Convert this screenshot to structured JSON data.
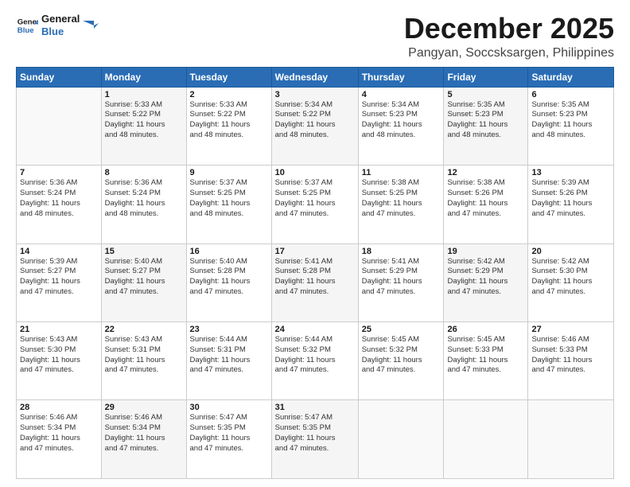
{
  "logo": {
    "line1": "General",
    "line2": "Blue"
  },
  "title": "December 2025",
  "subtitle": "Pangyan, Soccsksargen, Philippines",
  "weekdays": [
    "Sunday",
    "Monday",
    "Tuesday",
    "Wednesday",
    "Thursday",
    "Friday",
    "Saturday"
  ],
  "weeks": [
    [
      {
        "day": "",
        "info": ""
      },
      {
        "day": "1",
        "info": "Sunrise: 5:33 AM\nSunset: 5:22 PM\nDaylight: 11 hours\nand 48 minutes."
      },
      {
        "day": "2",
        "info": "Sunrise: 5:33 AM\nSunset: 5:22 PM\nDaylight: 11 hours\nand 48 minutes."
      },
      {
        "day": "3",
        "info": "Sunrise: 5:34 AM\nSunset: 5:22 PM\nDaylight: 11 hours\nand 48 minutes."
      },
      {
        "day": "4",
        "info": "Sunrise: 5:34 AM\nSunset: 5:23 PM\nDaylight: 11 hours\nand 48 minutes."
      },
      {
        "day": "5",
        "info": "Sunrise: 5:35 AM\nSunset: 5:23 PM\nDaylight: 11 hours\nand 48 minutes."
      },
      {
        "day": "6",
        "info": "Sunrise: 5:35 AM\nSunset: 5:23 PM\nDaylight: 11 hours\nand 48 minutes."
      }
    ],
    [
      {
        "day": "7",
        "info": "Sunrise: 5:36 AM\nSunset: 5:24 PM\nDaylight: 11 hours\nand 48 minutes."
      },
      {
        "day": "8",
        "info": "Sunrise: 5:36 AM\nSunset: 5:24 PM\nDaylight: 11 hours\nand 48 minutes."
      },
      {
        "day": "9",
        "info": "Sunrise: 5:37 AM\nSunset: 5:25 PM\nDaylight: 11 hours\nand 48 minutes."
      },
      {
        "day": "10",
        "info": "Sunrise: 5:37 AM\nSunset: 5:25 PM\nDaylight: 11 hours\nand 47 minutes."
      },
      {
        "day": "11",
        "info": "Sunrise: 5:38 AM\nSunset: 5:25 PM\nDaylight: 11 hours\nand 47 minutes."
      },
      {
        "day": "12",
        "info": "Sunrise: 5:38 AM\nSunset: 5:26 PM\nDaylight: 11 hours\nand 47 minutes."
      },
      {
        "day": "13",
        "info": "Sunrise: 5:39 AM\nSunset: 5:26 PM\nDaylight: 11 hours\nand 47 minutes."
      }
    ],
    [
      {
        "day": "14",
        "info": "Sunrise: 5:39 AM\nSunset: 5:27 PM\nDaylight: 11 hours\nand 47 minutes."
      },
      {
        "day": "15",
        "info": "Sunrise: 5:40 AM\nSunset: 5:27 PM\nDaylight: 11 hours\nand 47 minutes."
      },
      {
        "day": "16",
        "info": "Sunrise: 5:40 AM\nSunset: 5:28 PM\nDaylight: 11 hours\nand 47 minutes."
      },
      {
        "day": "17",
        "info": "Sunrise: 5:41 AM\nSunset: 5:28 PM\nDaylight: 11 hours\nand 47 minutes."
      },
      {
        "day": "18",
        "info": "Sunrise: 5:41 AM\nSunset: 5:29 PM\nDaylight: 11 hours\nand 47 minutes."
      },
      {
        "day": "19",
        "info": "Sunrise: 5:42 AM\nSunset: 5:29 PM\nDaylight: 11 hours\nand 47 minutes."
      },
      {
        "day": "20",
        "info": "Sunrise: 5:42 AM\nSunset: 5:30 PM\nDaylight: 11 hours\nand 47 minutes."
      }
    ],
    [
      {
        "day": "21",
        "info": "Sunrise: 5:43 AM\nSunset: 5:30 PM\nDaylight: 11 hours\nand 47 minutes."
      },
      {
        "day": "22",
        "info": "Sunrise: 5:43 AM\nSunset: 5:31 PM\nDaylight: 11 hours\nand 47 minutes."
      },
      {
        "day": "23",
        "info": "Sunrise: 5:44 AM\nSunset: 5:31 PM\nDaylight: 11 hours\nand 47 minutes."
      },
      {
        "day": "24",
        "info": "Sunrise: 5:44 AM\nSunset: 5:32 PM\nDaylight: 11 hours\nand 47 minutes."
      },
      {
        "day": "25",
        "info": "Sunrise: 5:45 AM\nSunset: 5:32 PM\nDaylight: 11 hours\nand 47 minutes."
      },
      {
        "day": "26",
        "info": "Sunrise: 5:45 AM\nSunset: 5:33 PM\nDaylight: 11 hours\nand 47 minutes."
      },
      {
        "day": "27",
        "info": "Sunrise: 5:46 AM\nSunset: 5:33 PM\nDaylight: 11 hours\nand 47 minutes."
      }
    ],
    [
      {
        "day": "28",
        "info": "Sunrise: 5:46 AM\nSunset: 5:34 PM\nDaylight: 11 hours\nand 47 minutes."
      },
      {
        "day": "29",
        "info": "Sunrise: 5:46 AM\nSunset: 5:34 PM\nDaylight: 11 hours\nand 47 minutes."
      },
      {
        "day": "30",
        "info": "Sunrise: 5:47 AM\nSunset: 5:35 PM\nDaylight: 11 hours\nand 47 minutes."
      },
      {
        "day": "31",
        "info": "Sunrise: 5:47 AM\nSunset: 5:35 PM\nDaylight: 11 hours\nand 47 minutes."
      },
      {
        "day": "",
        "info": ""
      },
      {
        "day": "",
        "info": ""
      },
      {
        "day": "",
        "info": ""
      }
    ]
  ]
}
